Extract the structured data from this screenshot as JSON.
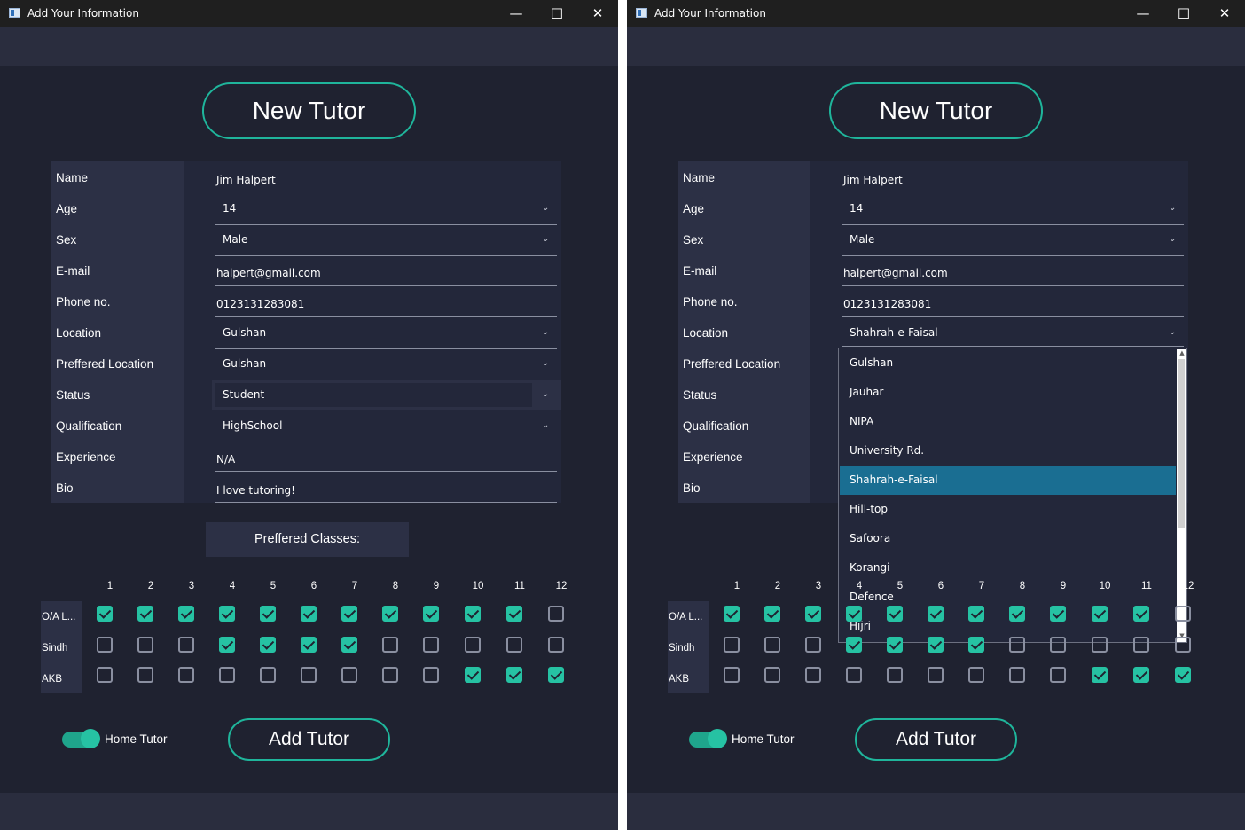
{
  "window": {
    "title": "Add Your Information",
    "minimize": "—",
    "maximize": "☐",
    "close": "✕"
  },
  "header": {
    "title": "New Tutor"
  },
  "form": {
    "labels": {
      "name": "Name",
      "age": "Age",
      "sex": "Sex",
      "email": "E-mail",
      "phone": "Phone no.",
      "location": "Location",
      "pref_location": "Preffered Location",
      "status": "Status",
      "qualification": "Qualification",
      "experience": "Experience",
      "bio": "Bio"
    },
    "values": {
      "name": "Jim Halpert",
      "age": "14",
      "sex": "Male",
      "email": "halpert@gmail.com",
      "phone": "0123131283081",
      "location": "Gulshan",
      "pref_location": "Gulshan",
      "status": "Student",
      "qualification": "HighSchool",
      "experience": "N/A",
      "bio": "I love tutoring!"
    }
  },
  "right_form": {
    "location": "Shahrah-e-Faisal"
  },
  "classes": {
    "label": "Preffered Classes:",
    "columns": [
      "1",
      "2",
      "3",
      "4",
      "5",
      "6",
      "7",
      "8",
      "9",
      "10",
      "11",
      "12"
    ],
    "rows": [
      {
        "name": "O/A L...",
        "checked": [
          true,
          true,
          true,
          true,
          true,
          true,
          true,
          true,
          true,
          true,
          true,
          false
        ]
      },
      {
        "name": "Sindh",
        "checked": [
          false,
          false,
          false,
          true,
          true,
          true,
          true,
          false,
          false,
          false,
          false,
          false
        ]
      },
      {
        "name": "AKB",
        "checked": [
          false,
          false,
          false,
          false,
          false,
          false,
          false,
          false,
          false,
          true,
          true,
          true
        ]
      }
    ]
  },
  "home_tutor": {
    "label": "Home Tutor",
    "on": true
  },
  "submit": {
    "label": "Add Tutor"
  },
  "location_dropdown": {
    "options": [
      "Gulshan",
      "Jauhar",
      "NIPA",
      "University Rd.",
      "Shahrah-e-Faisal",
      "Hill-top",
      "Safoora",
      "Korangi",
      "Defence",
      "Hijri"
    ],
    "selected": "Shahrah-e-Faisal"
  },
  "colors": {
    "accent": "#26c2a3",
    "background": "#1f2230",
    "panel": "#2c3045",
    "selection": "#1a6e92"
  }
}
